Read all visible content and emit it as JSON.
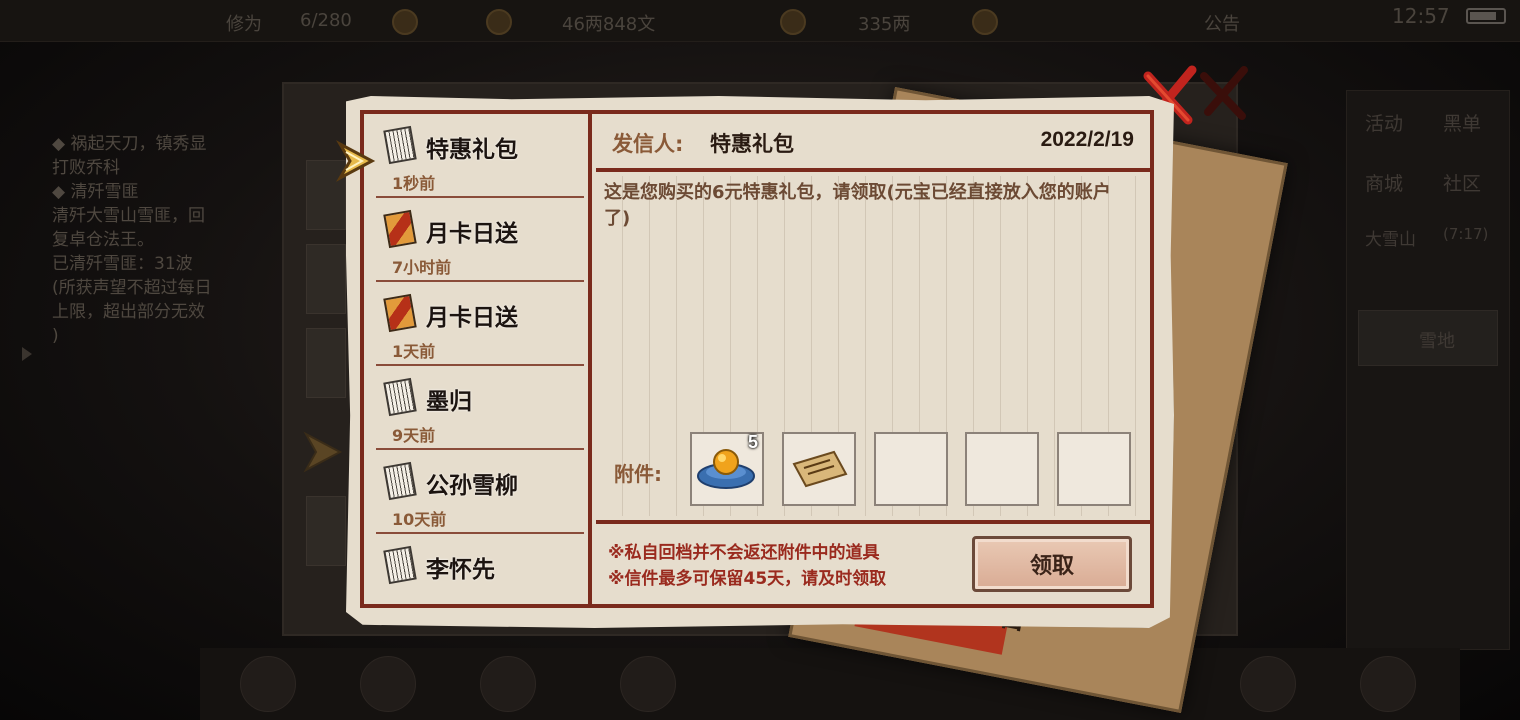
{
  "status_bar": {
    "time": "12:57"
  },
  "background": {
    "topbar": {
      "label1": "修为",
      "value1": "6/280",
      "value2": "46两848文",
      "value3": "335两",
      "notice": "公告"
    },
    "quest": {
      "lines": [
        "◆ 祸起天刀，镇秀显",
        "打败乔科",
        "◆ 清歼雪匪",
        "清歼大雪山雪匪，回",
        "复卓仓法王。",
        "已清歼雪匪：31波",
        "(所获声望不超过每日",
        "上限，超出部分无效",
        ")"
      ]
    },
    "right_panel": {
      "tab1": "活动",
      "tab2": "黑单",
      "tab3": "商城",
      "tab4": "社区",
      "location": "大雪山",
      "extra": "(7:17)",
      "place": "雪地"
    },
    "paper_char": "合"
  },
  "mail": {
    "list": [
      {
        "title": "特惠礼包",
        "time": "1秒前",
        "icon": "scroll-icon"
      },
      {
        "title": "月卡日送",
        "time": "7小时前",
        "icon": "card-icon"
      },
      {
        "title": "月卡日送",
        "time": "1天前",
        "icon": "card-icon"
      },
      {
        "title": "墨归",
        "time": "9天前",
        "icon": "scroll-icon"
      },
      {
        "title": "公孙雪柳",
        "time": "10天前",
        "icon": "scroll-icon"
      },
      {
        "title": "李怀先",
        "time": "",
        "icon": "scroll-icon"
      }
    ],
    "detail": {
      "sender_label": "发信人:",
      "sender": "特惠礼包",
      "date": "2022/2/19",
      "body": "这是您购买的6元特惠礼包，请领取(元宝已经直接放入您的账户了)",
      "attach_label": "附件:",
      "attachments": [
        {
          "icon": "gold-ingot-icon",
          "qty": "5"
        },
        {
          "icon": "scroll-paper-icon",
          "qty": ""
        },
        {
          "icon": "",
          "qty": ""
        },
        {
          "icon": "",
          "qty": ""
        },
        {
          "icon": "",
          "qty": ""
        }
      ],
      "notice1": "※私自回档并不会返还附件中的道具",
      "notice2": "※信件最多可保留45天，请及时领取",
      "claim_label": "领取"
    }
  },
  "colors": {
    "frame": "#7a2a1c",
    "paper": "#e6ddcd",
    "notice": "#9a2a1e",
    "close": "#c1241e"
  }
}
